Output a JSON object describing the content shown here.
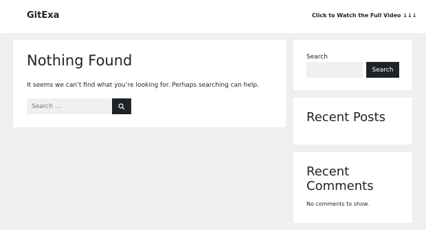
{
  "header": {
    "site_title": "GitExa",
    "top_link": "Click to Watch the Full Video ↓↓↓"
  },
  "main": {
    "title": "Nothing Found",
    "message": "It seems we can’t find what you’re looking for. Perhaps searching can help.",
    "search": {
      "placeholder": "Search …",
      "value": "",
      "button_icon": "search-icon"
    }
  },
  "sidebar": {
    "search_widget": {
      "label": "Search",
      "input_value": "",
      "button_label": "Search"
    },
    "recent_posts": {
      "title": "Recent Posts"
    },
    "recent_comments": {
      "title": "Recent Comments",
      "empty_text": "No comments to show."
    }
  },
  "colors": {
    "page_background": "#efeff0",
    "card_background": "#ffffff",
    "button_background": "#1f2328",
    "input_background": "#f0f0f1"
  }
}
